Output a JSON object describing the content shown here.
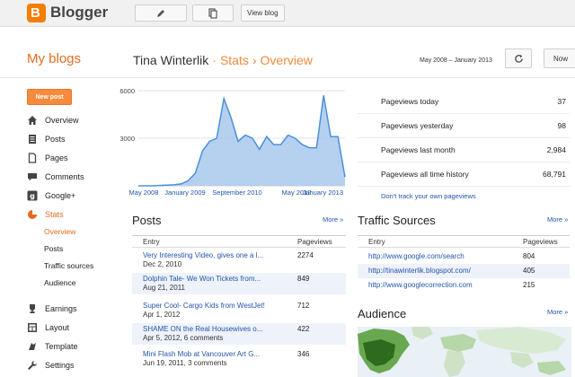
{
  "brand": {
    "name": "Blogger",
    "icon": "blogger-logo-icon"
  },
  "toolbar": {
    "view_blog": "View blog"
  },
  "header": {
    "my_blogs": "My blogs",
    "blog_name": "Tina Winterlik",
    "sep1": "·",
    "section": "Stats",
    "sep2": "›",
    "page": "Overview",
    "date_range": "May 2008 – January 2013",
    "now": "Now"
  },
  "sidebar": {
    "new_post": "New post",
    "items": [
      {
        "label": "Overview",
        "icon": "home-icon"
      },
      {
        "label": "Posts",
        "icon": "posts-icon"
      },
      {
        "label": "Pages",
        "icon": "pages-icon"
      },
      {
        "label": "Comments",
        "icon": "comments-icon"
      },
      {
        "label": "Google+",
        "icon": "google-plus-icon"
      },
      {
        "label": "Stats",
        "icon": "stats-icon"
      },
      {
        "label": "Earnings",
        "icon": "trophy-icon"
      },
      {
        "label": "Layout",
        "icon": "layout-icon"
      },
      {
        "label": "Template",
        "icon": "template-icon"
      },
      {
        "label": "Settings",
        "icon": "wrench-icon"
      }
    ],
    "stats_sub": [
      "Overview",
      "Posts",
      "Traffic sources",
      "Audience"
    ]
  },
  "chart_data": {
    "type": "area",
    "y_ticks": [
      "6000",
      "3000"
    ],
    "x_ticks": [
      "May 2008",
      "January 2009",
      "September 2010",
      "May 2012",
      "January 2013"
    ],
    "ylim": [
      0,
      6000
    ],
    "values": [
      0,
      0,
      0,
      20,
      40,
      60,
      120,
      320,
      800,
      2200,
      2800,
      3000,
      5500,
      4300,
      2800,
      3200,
      3000,
      2300,
      3100,
      2600,
      2600,
      3200,
      3000,
      2600,
      2400,
      2400,
      5700,
      3100,
      3100,
      550
    ],
    "fill": "#a9c9ec",
    "stroke": "#4a90d9"
  },
  "stats": [
    {
      "label": "Pageviews today",
      "value": "37"
    },
    {
      "label": "Pageviews yesterday",
      "value": "98"
    },
    {
      "label": "Pageviews last month",
      "value": "2,984"
    },
    {
      "label": "Pageviews all time history",
      "value": "68,791"
    }
  ],
  "dont_track": "Don't track your own pageviews",
  "posts": {
    "title": "Posts",
    "more": "More »",
    "col_entry": "Entry",
    "col_views": "Pageviews",
    "rows": [
      {
        "title": "Very Interesting Video, gives one a l...",
        "date": "Dec 2, 2010",
        "views": "2274"
      },
      {
        "title": "Dolphin Tale- We Won Tickets from...",
        "date": "Aug 21, 2011",
        "views": "849"
      },
      {
        "title": "Super Cool- Cargo Kids from WestJet!",
        "date": "Apr 1, 2012",
        "views": "712"
      },
      {
        "title": "SHAME ON the Real Housewives o...",
        "date": "Apr 5, 2012, 6 comments",
        "views": "422"
      },
      {
        "title": "Mini Flash Mob at Vancouver Art G...",
        "date": "Jun 19, 2011, 3 comments",
        "views": "346"
      }
    ]
  },
  "traffic": {
    "title": "Traffic Sources",
    "more": "More »",
    "col_entry": "Entry",
    "col_views": "Pageviews",
    "rows": [
      {
        "url": "http://www.google.com/search",
        "views": "804"
      },
      {
        "url": "http://tinawinterlik.blogspot.com/",
        "views": "405"
      },
      {
        "url": "http://www.googlecorrection.com",
        "views": "215"
      }
    ]
  },
  "audience": {
    "title": "Audience",
    "more": "More »"
  }
}
